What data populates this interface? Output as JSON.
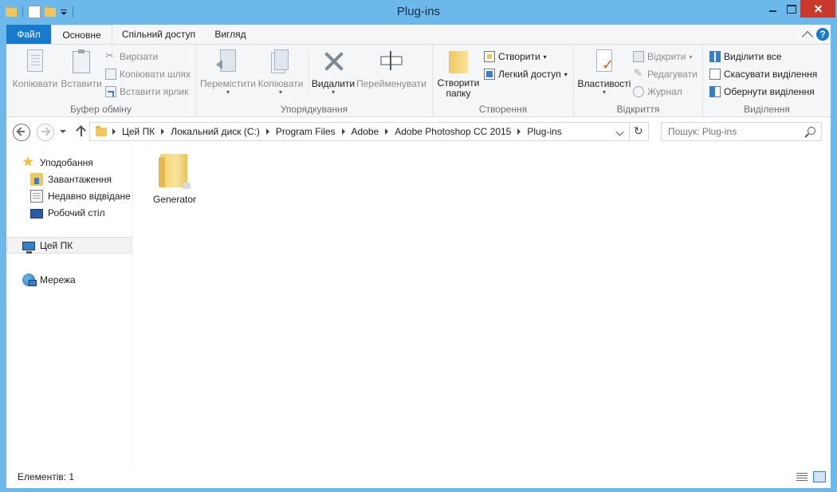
{
  "window": {
    "title": "Plug-ins"
  },
  "ribbon_tabs": {
    "file": "Файл",
    "home": "Основне",
    "share": "Спільний доступ",
    "view": "Вигляд",
    "help": "?"
  },
  "ribbon": {
    "clipboard": {
      "label": "Буфер обміну",
      "copy": "Копіювати",
      "paste": "Вставити",
      "cut": "Вирізати",
      "copy_path": "Копіювати шлях",
      "paste_shortcut": "Вставити ярлик"
    },
    "organize": {
      "label": "Упорядкування",
      "move_to": "Перемістити",
      "copy_to": "Копіювати",
      "delete": "Видалити",
      "rename": "Перейменувати"
    },
    "new": {
      "label": "Створення",
      "new_folder_line1": "Створити",
      "new_folder_line2": "папку",
      "new_item": "Створити",
      "easy_access": "Легкий доступ"
    },
    "open": {
      "label": "Відкриття",
      "properties": "Властивості",
      "open": "Відкрити",
      "edit": "Редагувати",
      "history": "Журнал"
    },
    "select": {
      "label": "Виділення",
      "select_all": "Виділити все",
      "select_none": "Скасувати виділення",
      "invert": "Обернути виділення"
    }
  },
  "address_bar": {
    "crumbs": [
      "Цей ПК",
      "Локальний диск (C:)",
      "Program Files",
      "Adobe",
      "Adobe Photoshop CC 2015",
      "Plug-ins"
    ]
  },
  "search": {
    "placeholder": "Пошук: Plug-ins"
  },
  "nav_pane": {
    "favorites": "Уподобання",
    "downloads": "Завантаження",
    "recent": "Недавно відвідане",
    "desktop": "Робочий стіл",
    "this_pc": "Цей ПК",
    "network": "Мережа"
  },
  "files": [
    {
      "name": "Generator",
      "type": "folder"
    }
  ],
  "status": {
    "items": "Елементів: 1"
  },
  "colors": {
    "titlebar": "#6cb8ea",
    "file_tab": "#1979ca",
    "close_button": "#c8392b",
    "folder": "#f0c75e"
  },
  "icons": {
    "qat": [
      "folder-icon",
      "properties-icon",
      "new-folder-icon",
      "customize-dropdown-icon"
    ]
  }
}
